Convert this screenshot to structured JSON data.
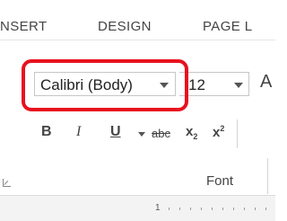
{
  "tabs": {
    "insert": "NSERT",
    "design": "DESIGN",
    "page_layout": "PAGE L"
  },
  "font": {
    "family": "Calibri (Body)",
    "size": "12",
    "grow_font": "A"
  },
  "formatting": {
    "bold": "B",
    "italic": "I",
    "underline": "U",
    "strikethrough": "abc",
    "subscript": "x",
    "subscript_mark": "2",
    "superscript": "x",
    "superscript_mark": "2"
  },
  "group_label": "Font",
  "ruler": {
    "number": "1"
  },
  "colors": {
    "highlight": "#e8111e",
    "text": "#444444"
  }
}
